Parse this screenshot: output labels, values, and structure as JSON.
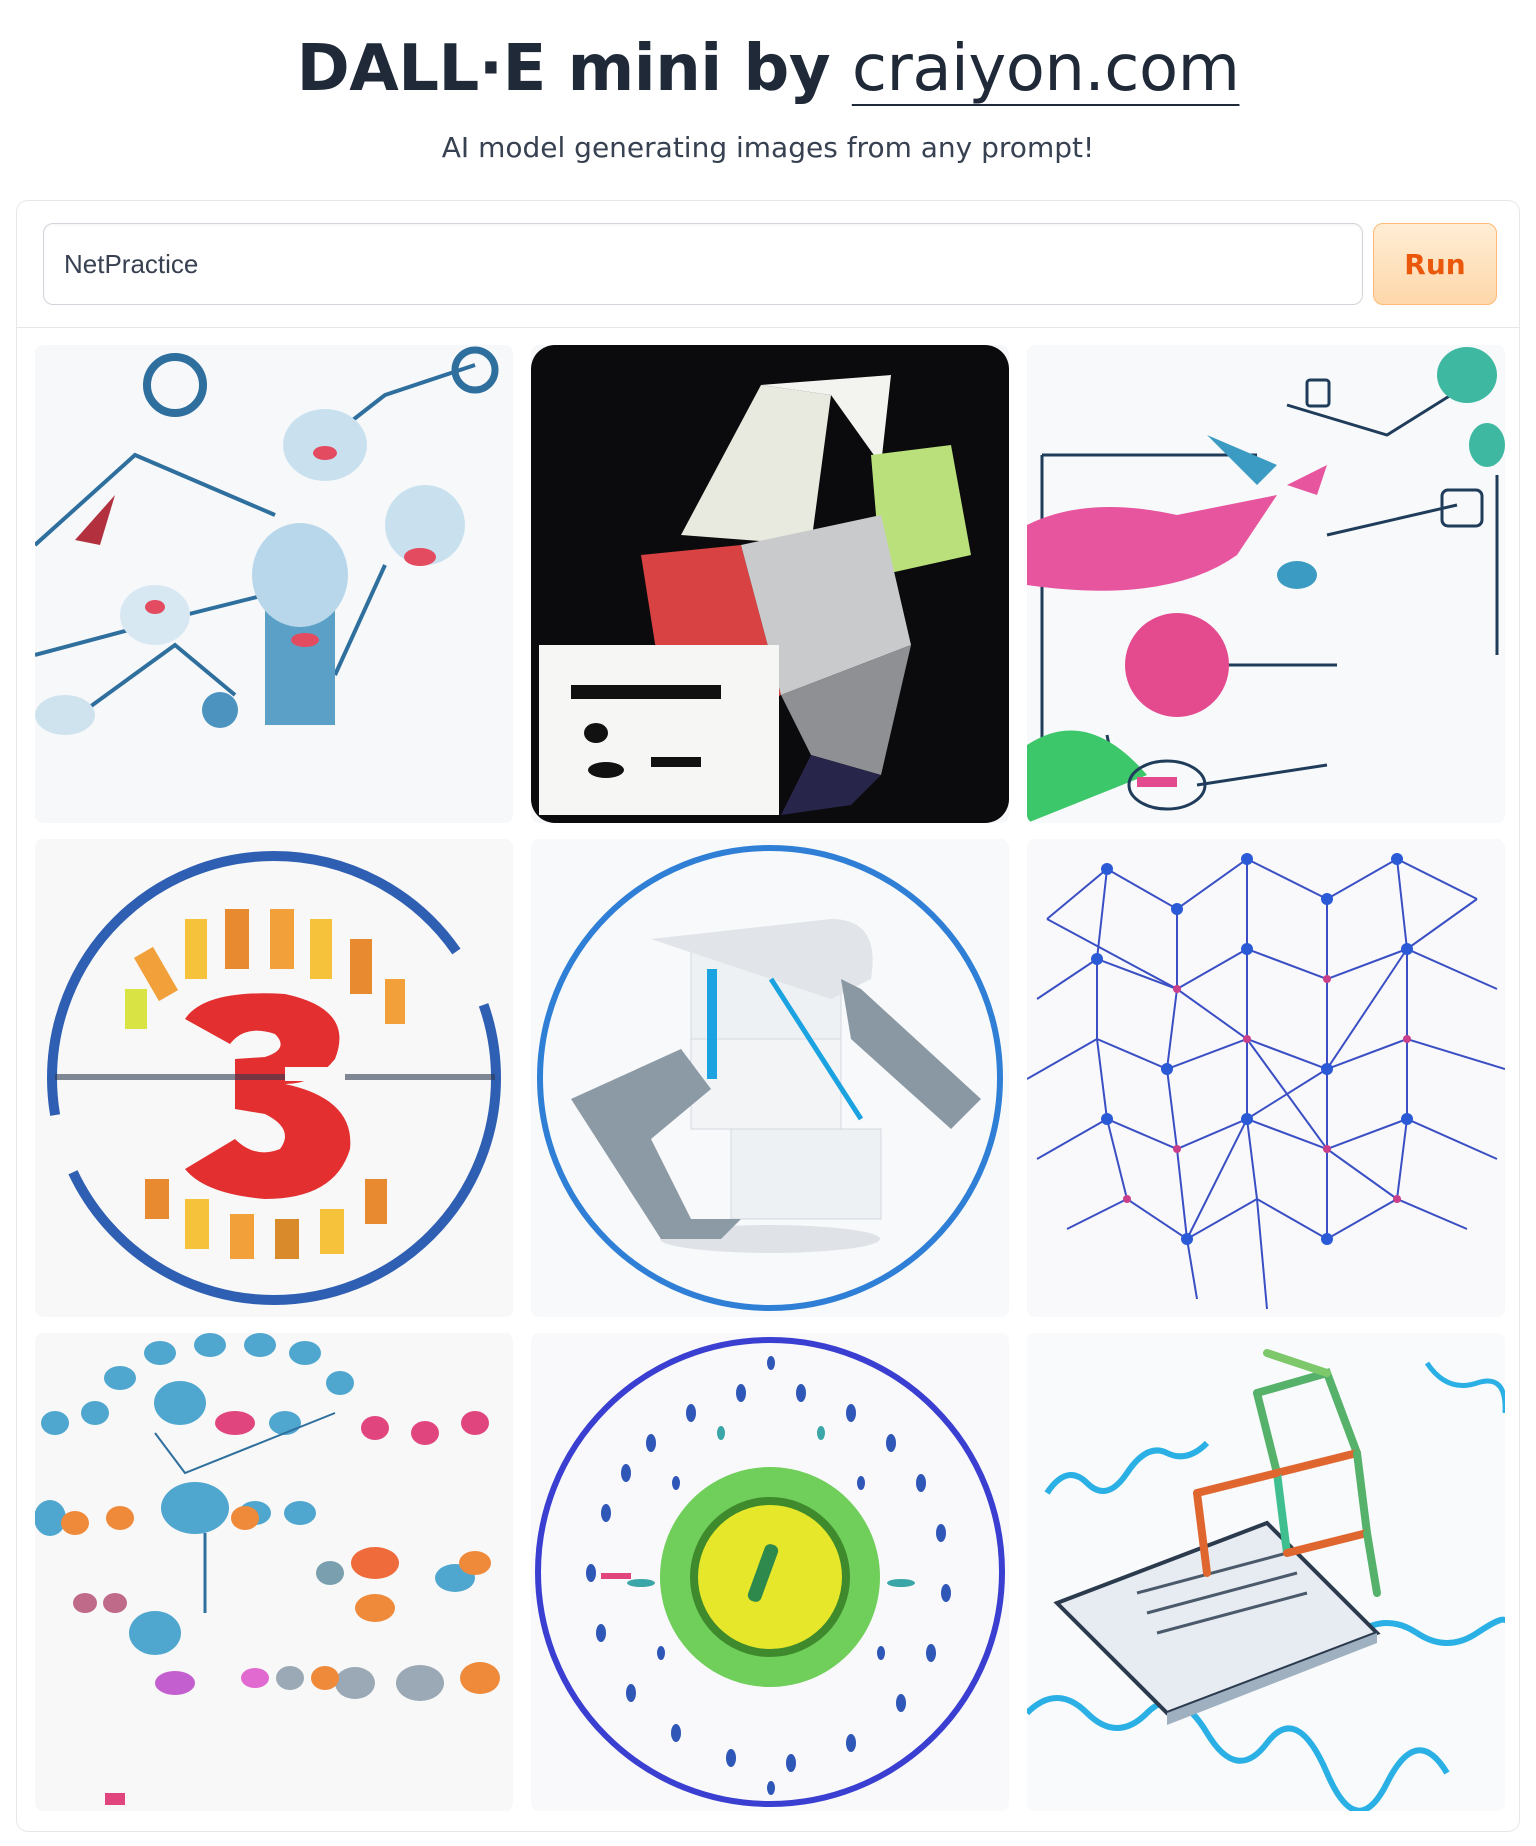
{
  "header": {
    "title_prefix": "DALL·E mini by",
    "title_link": "craiyon.com",
    "subtitle": "AI model generating images from any prompt!"
  },
  "prompt": {
    "value": "NetPractice"
  },
  "run_button": {
    "label": "Run"
  },
  "results": [
    {
      "description": "blue network nodes connected by lines"
    },
    {
      "description": "folded paper cubes on black background"
    },
    {
      "description": "pink and teal abstract diagram with nodes"
    },
    {
      "description": "red number three inside colorful ring"
    },
    {
      "description": "white cube stack with grey arms in blue circle"
    },
    {
      "description": "blue and purple mesh network sphere"
    },
    {
      "description": "chain of colored dots with central node"
    },
    {
      "description": "green and yellow badge inside dotted circle"
    },
    {
      "description": "laptop with colored wire cube"
    }
  ]
}
